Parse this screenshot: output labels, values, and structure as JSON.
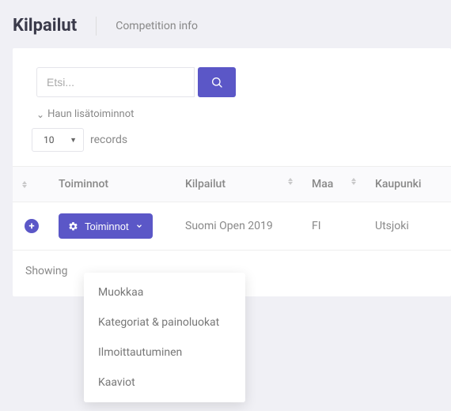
{
  "header": {
    "title": "Kilpailut",
    "subtitle": "Competition info"
  },
  "search": {
    "placeholder": "Etsi..."
  },
  "advanced_search": {
    "chevron": "⌄",
    "label": "Haun lisätoiminnot"
  },
  "records": {
    "value": "10",
    "label": "records"
  },
  "columns": {
    "actions": "Toiminnot",
    "competition": "Kilpailut",
    "country": "Maa",
    "city": "Kaupunki"
  },
  "rows": [
    {
      "action_label": "Toiminnot",
      "competition": "Suomi Open 2019",
      "country": "FI",
      "city": "Utsjoki"
    }
  ],
  "dropdown": {
    "edit": "Muokkaa",
    "categories": "Kategoriat & painoluokat",
    "registration": "Ilmoittautuminen",
    "charts": "Kaaviot"
  },
  "footer": {
    "showing": "Showing"
  }
}
